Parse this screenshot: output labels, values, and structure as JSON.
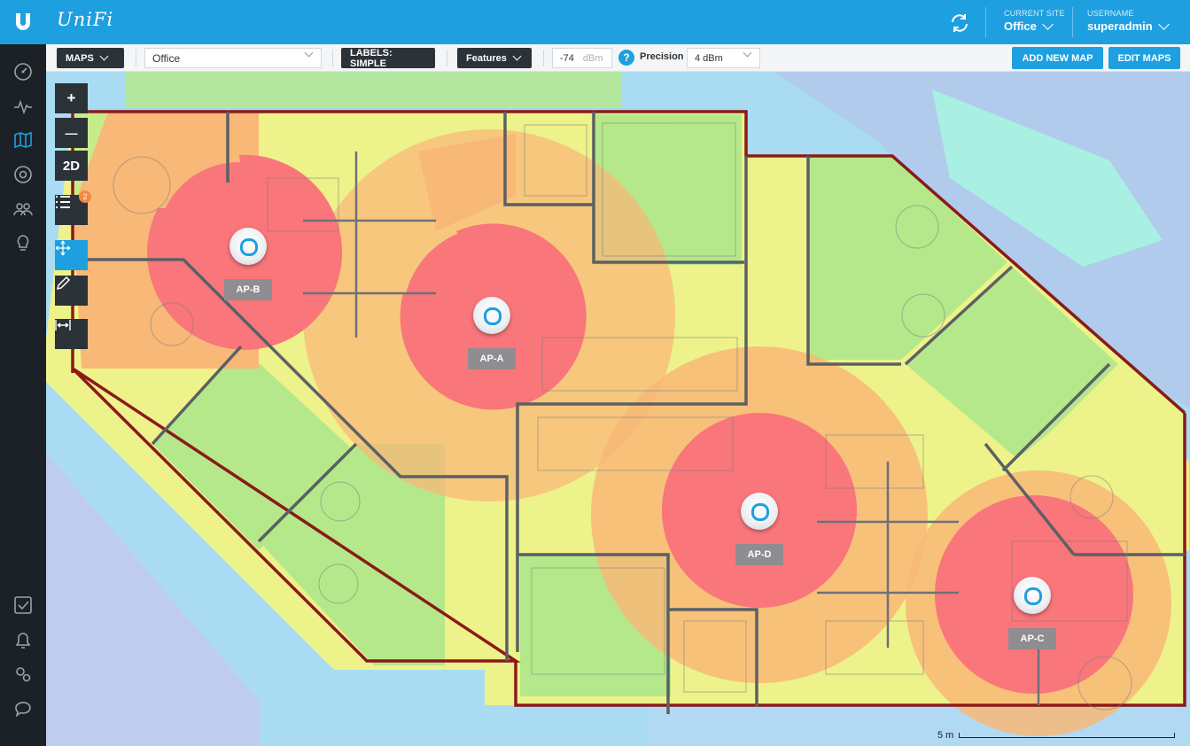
{
  "app": {
    "brand": "UniFi"
  },
  "header": {
    "site_label": "CURRENT SITE",
    "site_value": "Office",
    "user_label": "USERNAME",
    "user_value": "superadmin"
  },
  "sidebar": {
    "items": [
      {
        "name": "dashboard-icon"
      },
      {
        "name": "statistics-icon"
      },
      {
        "name": "map-icon",
        "active": true
      },
      {
        "name": "devices-icon"
      },
      {
        "name": "clients-icon"
      },
      {
        "name": "insights-icon"
      }
    ],
    "bottom_items": [
      {
        "name": "tasks-icon"
      },
      {
        "name": "alerts-icon"
      },
      {
        "name": "settings-icon"
      },
      {
        "name": "chat-icon"
      }
    ]
  },
  "toolbar": {
    "maps_label": "MAPS",
    "map_select": "Office",
    "labels_button": "LABELS: SIMPLE",
    "features_button": "Features",
    "signal_value": "-74",
    "signal_unit": "dBm",
    "precision_label": "Precision",
    "precision_value": "4 dBm",
    "add_map": "ADD NEW MAP",
    "edit_maps": "EDIT MAPS"
  },
  "map_tools": {
    "zoom_in": "+",
    "zoom_out": "—",
    "view_mode": "2D",
    "list_badge": "2"
  },
  "access_points": [
    {
      "label": "AP-B"
    },
    {
      "label": "AP-A"
    },
    {
      "label": "AP-D"
    },
    {
      "label": "AP-C"
    }
  ],
  "scale": {
    "label": "5 m"
  },
  "colors": {
    "accent": "#1e9fe0",
    "dark": "#2b3238",
    "heat_strong": "#f9767a",
    "heat_good": "#f8b877",
    "heat_fair": "#eef28a",
    "heat_ok": "#b5e88a",
    "heat_weak": "#a9f0e2",
    "wall": "#8a1a1a"
  }
}
